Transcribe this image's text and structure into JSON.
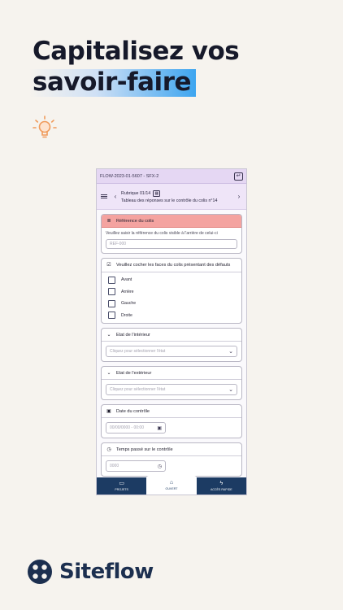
{
  "hero": {
    "line1": "Capitalisez vos",
    "line2": "savoir-faire"
  },
  "phone": {
    "topbar": {
      "title": "FLOW-2023-01-5607 - SFX-2"
    },
    "header": {
      "rubrique": "Rubrique 01/14",
      "subtitle": "Tableau des réponses sur le contrôle du colis n°14"
    },
    "sections": {
      "reference": {
        "title": "Référence du colis",
        "instruction": "Veuillez saisir la référence du colis visible à l'arrière de celui-ci",
        "placeholder": "REF-000"
      },
      "faces": {
        "title": "Veuillez cocher les faces du colis présentant des défauts",
        "options": [
          "Avant",
          "Arrière",
          "Gauche",
          "Droite"
        ]
      },
      "interior": {
        "title": "Etat de l'intérieur",
        "placeholder": "Cliquez pour sélectionner l'état"
      },
      "exterior": {
        "title": "Etat de l'extérieur",
        "placeholder": "Cliquez pour sélectionner l'état"
      },
      "date": {
        "title": "Date du contrôle",
        "placeholder": "00/00/0000 - 00:00"
      },
      "time": {
        "title": "Temps passé sur le contrôle",
        "placeholder": "0000"
      }
    },
    "nav": [
      {
        "label": "PROJETS",
        "icon": "folder-icon"
      },
      {
        "label": "OUVERT",
        "icon": "inbox-icon"
      },
      {
        "label": "ACCÈS RAPIDE",
        "icon": "lightning-icon"
      }
    ]
  },
  "brand": {
    "name": "Siteflow"
  },
  "colors": {
    "background": "#f6f3ee",
    "nav": "#1c3b63",
    "header": "#e5d7f3",
    "alert": "#f4a3a0",
    "accent": "#3da5f0",
    "bulb": "#f09a5a"
  }
}
